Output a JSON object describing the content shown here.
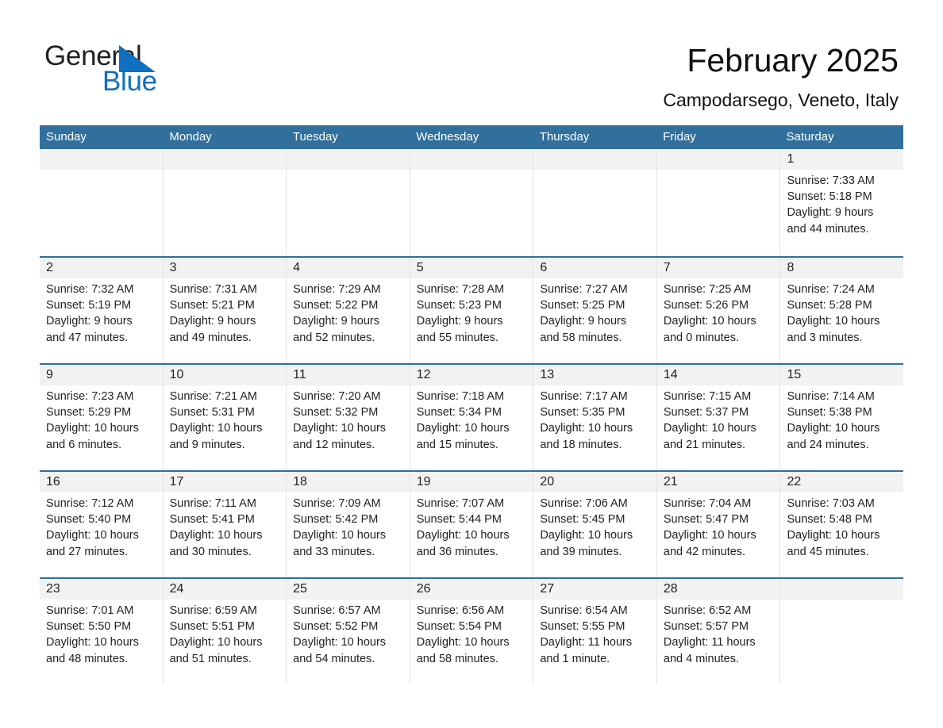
{
  "brand": {
    "name_part1": "General",
    "name_part2": "Blue",
    "triangle_color": "#0f6fc0",
    "text_color": "#231f20"
  },
  "header": {
    "title": "February 2025",
    "subtitle": "Campodarsego, Veneto, Italy"
  },
  "theme": {
    "header_blue": "#31709c",
    "row_divider_blue": "#31709c",
    "daynum_band": "#f2f2f2",
    "cell_divider": "#e3e3e3"
  },
  "weekday_headers": [
    "Sunday",
    "Monday",
    "Tuesday",
    "Wednesday",
    "Thursday",
    "Friday",
    "Saturday"
  ],
  "weeks": [
    [
      {
        "day": "",
        "sunrise": "",
        "sunset": "",
        "daylight_line1": "",
        "daylight_line2": "",
        "empty": true
      },
      {
        "day": "",
        "sunrise": "",
        "sunset": "",
        "daylight_line1": "",
        "daylight_line2": "",
        "empty": true
      },
      {
        "day": "",
        "sunrise": "",
        "sunset": "",
        "daylight_line1": "",
        "daylight_line2": "",
        "empty": true
      },
      {
        "day": "",
        "sunrise": "",
        "sunset": "",
        "daylight_line1": "",
        "daylight_line2": "",
        "empty": true
      },
      {
        "day": "",
        "sunrise": "",
        "sunset": "",
        "daylight_line1": "",
        "daylight_line2": "",
        "empty": true
      },
      {
        "day": "",
        "sunrise": "",
        "sunset": "",
        "daylight_line1": "",
        "daylight_line2": "",
        "empty": true
      },
      {
        "day": "1",
        "sunrise": "Sunrise: 7:33 AM",
        "sunset": "Sunset: 5:18 PM",
        "daylight_line1": "Daylight: 9 hours",
        "daylight_line2": "and 44 minutes.",
        "empty": false
      }
    ],
    [
      {
        "day": "2",
        "sunrise": "Sunrise: 7:32 AM",
        "sunset": "Sunset: 5:19 PM",
        "daylight_line1": "Daylight: 9 hours",
        "daylight_line2": "and 47 minutes.",
        "empty": false
      },
      {
        "day": "3",
        "sunrise": "Sunrise: 7:31 AM",
        "sunset": "Sunset: 5:21 PM",
        "daylight_line1": "Daylight: 9 hours",
        "daylight_line2": "and 49 minutes.",
        "empty": false
      },
      {
        "day": "4",
        "sunrise": "Sunrise: 7:29 AM",
        "sunset": "Sunset: 5:22 PM",
        "daylight_line1": "Daylight: 9 hours",
        "daylight_line2": "and 52 minutes.",
        "empty": false
      },
      {
        "day": "5",
        "sunrise": "Sunrise: 7:28 AM",
        "sunset": "Sunset: 5:23 PM",
        "daylight_line1": "Daylight: 9 hours",
        "daylight_line2": "and 55 minutes.",
        "empty": false
      },
      {
        "day": "6",
        "sunrise": "Sunrise: 7:27 AM",
        "sunset": "Sunset: 5:25 PM",
        "daylight_line1": "Daylight: 9 hours",
        "daylight_line2": "and 58 minutes.",
        "empty": false
      },
      {
        "day": "7",
        "sunrise": "Sunrise: 7:25 AM",
        "sunset": "Sunset: 5:26 PM",
        "daylight_line1": "Daylight: 10 hours",
        "daylight_line2": "and 0 minutes.",
        "empty": false
      },
      {
        "day": "8",
        "sunrise": "Sunrise: 7:24 AM",
        "sunset": "Sunset: 5:28 PM",
        "daylight_line1": "Daylight: 10 hours",
        "daylight_line2": "and 3 minutes.",
        "empty": false
      }
    ],
    [
      {
        "day": "9",
        "sunrise": "Sunrise: 7:23 AM",
        "sunset": "Sunset: 5:29 PM",
        "daylight_line1": "Daylight: 10 hours",
        "daylight_line2": "and 6 minutes.",
        "empty": false
      },
      {
        "day": "10",
        "sunrise": "Sunrise: 7:21 AM",
        "sunset": "Sunset: 5:31 PM",
        "daylight_line1": "Daylight: 10 hours",
        "daylight_line2": "and 9 minutes.",
        "empty": false
      },
      {
        "day": "11",
        "sunrise": "Sunrise: 7:20 AM",
        "sunset": "Sunset: 5:32 PM",
        "daylight_line1": "Daylight: 10 hours",
        "daylight_line2": "and 12 minutes.",
        "empty": false
      },
      {
        "day": "12",
        "sunrise": "Sunrise: 7:18 AM",
        "sunset": "Sunset: 5:34 PM",
        "daylight_line1": "Daylight: 10 hours",
        "daylight_line2": "and 15 minutes.",
        "empty": false
      },
      {
        "day": "13",
        "sunrise": "Sunrise: 7:17 AM",
        "sunset": "Sunset: 5:35 PM",
        "daylight_line1": "Daylight: 10 hours",
        "daylight_line2": "and 18 minutes.",
        "empty": false
      },
      {
        "day": "14",
        "sunrise": "Sunrise: 7:15 AM",
        "sunset": "Sunset: 5:37 PM",
        "daylight_line1": "Daylight: 10 hours",
        "daylight_line2": "and 21 minutes.",
        "empty": false
      },
      {
        "day": "15",
        "sunrise": "Sunrise: 7:14 AM",
        "sunset": "Sunset: 5:38 PM",
        "daylight_line1": "Daylight: 10 hours",
        "daylight_line2": "and 24 minutes.",
        "empty": false
      }
    ],
    [
      {
        "day": "16",
        "sunrise": "Sunrise: 7:12 AM",
        "sunset": "Sunset: 5:40 PM",
        "daylight_line1": "Daylight: 10 hours",
        "daylight_line2": "and 27 minutes.",
        "empty": false
      },
      {
        "day": "17",
        "sunrise": "Sunrise: 7:11 AM",
        "sunset": "Sunset: 5:41 PM",
        "daylight_line1": "Daylight: 10 hours",
        "daylight_line2": "and 30 minutes.",
        "empty": false
      },
      {
        "day": "18",
        "sunrise": "Sunrise: 7:09 AM",
        "sunset": "Sunset: 5:42 PM",
        "daylight_line1": "Daylight: 10 hours",
        "daylight_line2": "and 33 minutes.",
        "empty": false
      },
      {
        "day": "19",
        "sunrise": "Sunrise: 7:07 AM",
        "sunset": "Sunset: 5:44 PM",
        "daylight_line1": "Daylight: 10 hours",
        "daylight_line2": "and 36 minutes.",
        "empty": false
      },
      {
        "day": "20",
        "sunrise": "Sunrise: 7:06 AM",
        "sunset": "Sunset: 5:45 PM",
        "daylight_line1": "Daylight: 10 hours",
        "daylight_line2": "and 39 minutes.",
        "empty": false
      },
      {
        "day": "21",
        "sunrise": "Sunrise: 7:04 AM",
        "sunset": "Sunset: 5:47 PM",
        "daylight_line1": "Daylight: 10 hours",
        "daylight_line2": "and 42 minutes.",
        "empty": false
      },
      {
        "day": "22",
        "sunrise": "Sunrise: 7:03 AM",
        "sunset": "Sunset: 5:48 PM",
        "daylight_line1": "Daylight: 10 hours",
        "daylight_line2": "and 45 minutes.",
        "empty": false
      }
    ],
    [
      {
        "day": "23",
        "sunrise": "Sunrise: 7:01 AM",
        "sunset": "Sunset: 5:50 PM",
        "daylight_line1": "Daylight: 10 hours",
        "daylight_line2": "and 48 minutes.",
        "empty": false
      },
      {
        "day": "24",
        "sunrise": "Sunrise: 6:59 AM",
        "sunset": "Sunset: 5:51 PM",
        "daylight_line1": "Daylight: 10 hours",
        "daylight_line2": "and 51 minutes.",
        "empty": false
      },
      {
        "day": "25",
        "sunrise": "Sunrise: 6:57 AM",
        "sunset": "Sunset: 5:52 PM",
        "daylight_line1": "Daylight: 10 hours",
        "daylight_line2": "and 54 minutes.",
        "empty": false
      },
      {
        "day": "26",
        "sunrise": "Sunrise: 6:56 AM",
        "sunset": "Sunset: 5:54 PM",
        "daylight_line1": "Daylight: 10 hours",
        "daylight_line2": "and 58 minutes.",
        "empty": false
      },
      {
        "day": "27",
        "sunrise": "Sunrise: 6:54 AM",
        "sunset": "Sunset: 5:55 PM",
        "daylight_line1": "Daylight: 11 hours",
        "daylight_line2": "and 1 minute.",
        "empty": false
      },
      {
        "day": "28",
        "sunrise": "Sunrise: 6:52 AM",
        "sunset": "Sunset: 5:57 PM",
        "daylight_line1": "Daylight: 11 hours",
        "daylight_line2": "and 4 minutes.",
        "empty": false
      },
      {
        "day": "",
        "sunrise": "",
        "sunset": "",
        "daylight_line1": "",
        "daylight_line2": "",
        "empty": true
      }
    ]
  ]
}
